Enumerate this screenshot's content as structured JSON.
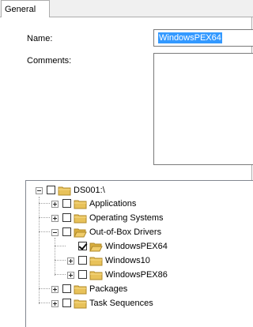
{
  "tabs": [
    {
      "label": "General"
    }
  ],
  "fields": {
    "name_label": "Name:",
    "name_value": "WindowsPEX64",
    "comments_label": "Comments:",
    "comments_value": ""
  },
  "tree": {
    "root": {
      "label": "DS001:\\",
      "expanded": true,
      "checked": false
    },
    "items": [
      {
        "label": "Applications",
        "expander": "plus",
        "checked": false
      },
      {
        "label": "Operating Systems",
        "expander": "plus",
        "checked": false
      },
      {
        "label": "Out-of-Box Drivers",
        "expander": "minus",
        "checked": false
      },
      {
        "label": "WindowsPEX64",
        "expander": "none",
        "checked": true
      },
      {
        "label": "Windows10",
        "expander": "plus",
        "checked": false
      },
      {
        "label": "WindowsPEX86",
        "expander": "plus",
        "checked": false
      },
      {
        "label": "Packages",
        "expander": "plus",
        "checked": false
      },
      {
        "label": "Task Sequences",
        "expander": "plus",
        "checked": false
      }
    ]
  },
  "colors": {
    "selection": "#3399ff",
    "folder": "#e8c25a"
  }
}
